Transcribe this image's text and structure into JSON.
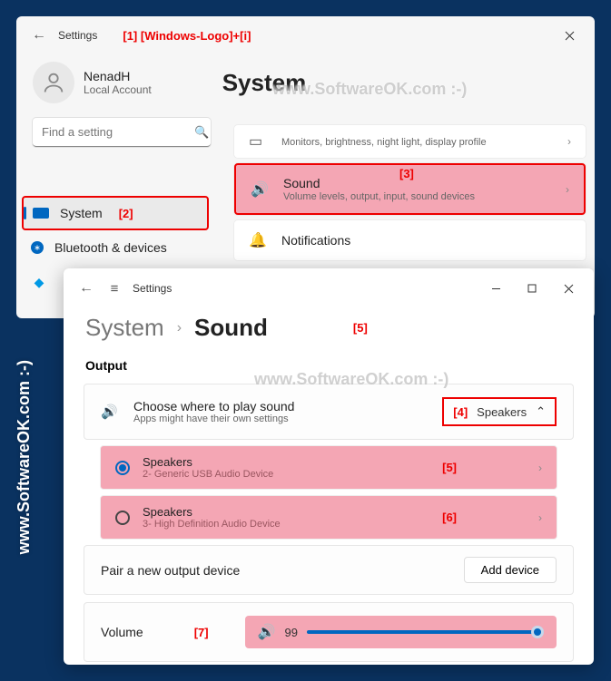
{
  "annotations": {
    "a1": "[1]  [Windows-Logo]+[i]",
    "a2": "[2]",
    "a3": "[3]",
    "a4": "[4]",
    "a5": "[5]",
    "a5b": "[5]",
    "a6": "[6]",
    "a7": "[7]"
  },
  "watermarks": {
    "w1": "www.SoftwareOK.com  :-)",
    "w2": "www.SoftwareOK.com :-)",
    "w3": "www.SoftwareOK.com :-)"
  },
  "window1": {
    "title": "Settings",
    "user": {
      "name": "NenadH",
      "sub": "Local Account"
    },
    "heading": "System",
    "search_placeholder": "Find a setting",
    "sidebar": [
      {
        "label": "System"
      },
      {
        "label": "Bluetooth & devices"
      },
      {
        "label": ""
      }
    ],
    "list": [
      {
        "title": "",
        "sub": "Monitors, brightness, night light, display profile"
      },
      {
        "title": "Sound",
        "sub": "Volume levels, output, input, sound devices"
      },
      {
        "title": "Notifications",
        "sub": ""
      }
    ]
  },
  "window2": {
    "title": "Settings",
    "breadcrumb": {
      "parent": "System",
      "current": "Sound"
    },
    "section_output": "Output",
    "choose": {
      "title": "Choose where to play sound",
      "sub": "Apps might have their own settings",
      "value": "Speakers"
    },
    "devices": [
      {
        "title": "Speakers",
        "sub": "2- Generic USB Audio Device"
      },
      {
        "title": "Speakers",
        "sub": "3- High Definition Audio Device"
      }
    ],
    "pair": {
      "label": "Pair a new output device",
      "button": "Add device"
    },
    "volume": {
      "label": "Volume",
      "value": "99"
    }
  }
}
